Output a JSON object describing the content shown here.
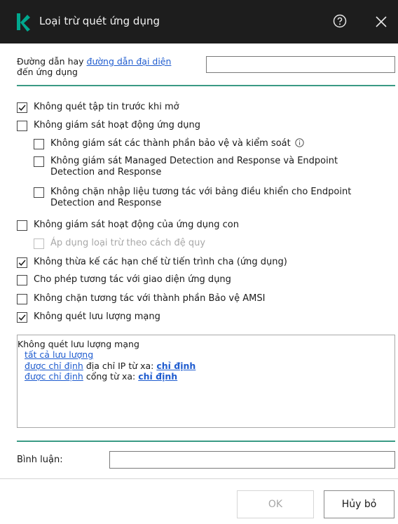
{
  "window": {
    "title": "Loại trừ quét ứng dụng"
  },
  "path": {
    "label_prefix": "Đường dẫn hay ",
    "label_link": "đường dẫn đại diện",
    "label_suffix": "đến ứng dụng",
    "value": ""
  },
  "options": [
    {
      "label": "Không quét tập tin trước khi mở",
      "checked": true,
      "disabled": false
    },
    {
      "label": "Không giám sát hoạt động ứng dụng",
      "checked": false,
      "disabled": false
    },
    {
      "label": "Không giám sát các thành phần bảo vệ và kiểm soát",
      "checked": false,
      "disabled": false
    },
    {
      "label": "Không giám sát Managed Detection and Response và Endpoint Detection and Response",
      "checked": false,
      "disabled": false
    },
    {
      "label": "Không chặn nhập liệu tương tác với bảng điều khiển cho Endpoint Detection and Response",
      "checked": false,
      "disabled": false
    },
    {
      "label": "Không giám sát hoạt động của ứng dụng con",
      "checked": false,
      "disabled": false
    },
    {
      "label": "Áp dụng loại trừ theo cách đệ quy",
      "checked": false,
      "disabled": true
    },
    {
      "label": "Không thừa kế các hạn chế từ tiến trình cha (ứng dụng)",
      "checked": true,
      "disabled": false
    },
    {
      "label": "Cho phép tương tác với giao diện ứng dụng",
      "checked": false,
      "disabled": false
    },
    {
      "label": "Không chặn tương tác với thành phần Bảo vệ AMSI",
      "checked": false,
      "disabled": false
    },
    {
      "label": "Không quét lưu lượng mạng",
      "checked": true,
      "disabled": false
    }
  ],
  "network": {
    "heading": "Không quét lưu lượng mạng",
    "all_traffic_link": "tất cả lưu lượng",
    "ip_line": {
      "link": "được chỉ định",
      "text": " địa chỉ IP từ xa: ",
      "value_link": "chỉ định"
    },
    "port_line": {
      "link": "được chỉ định",
      "text": " cổng từ xa: ",
      "value_link": "chỉ định"
    }
  },
  "comment": {
    "label": "Bình luận:",
    "value": ""
  },
  "buttons": {
    "ok": "OK",
    "cancel": "Hủy bỏ"
  },
  "colors": {
    "titlebar": "#1d1d1d",
    "accent": "#00a88e",
    "link": "#1f5ccf",
    "separator": "#3a9a84"
  },
  "icons": {
    "logo": "kaspersky-k-icon",
    "help": "help-circle-icon",
    "close": "close-icon",
    "info": "info-icon",
    "check": "checkmark-icon"
  }
}
